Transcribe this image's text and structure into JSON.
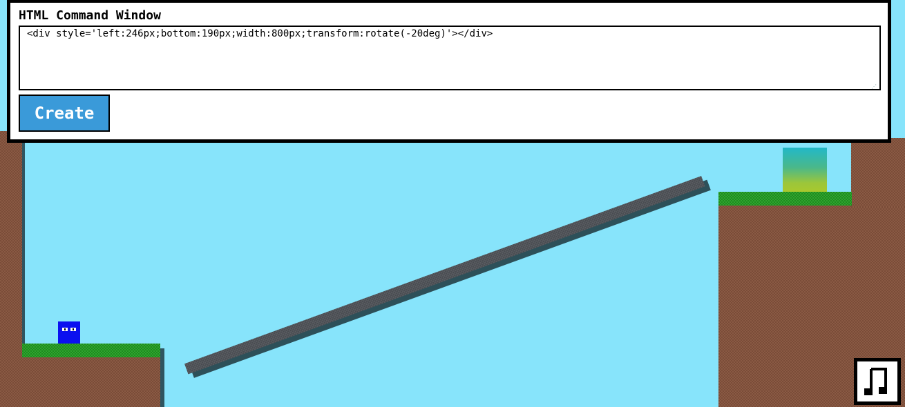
{
  "command_window": {
    "title": "HTML Command Window",
    "code": "<div style='left:246px;bottom:190px;width:800px;transform:rotate(-20deg)'></div>",
    "create_label": "Create"
  },
  "colors": {
    "sky": "#87e4fb",
    "player": "#0b10f0",
    "button": "#3a9ad9",
    "grass": "#2fa52f",
    "dirt": "#8a5a44"
  },
  "icons": {
    "music": "music-note-icon"
  }
}
